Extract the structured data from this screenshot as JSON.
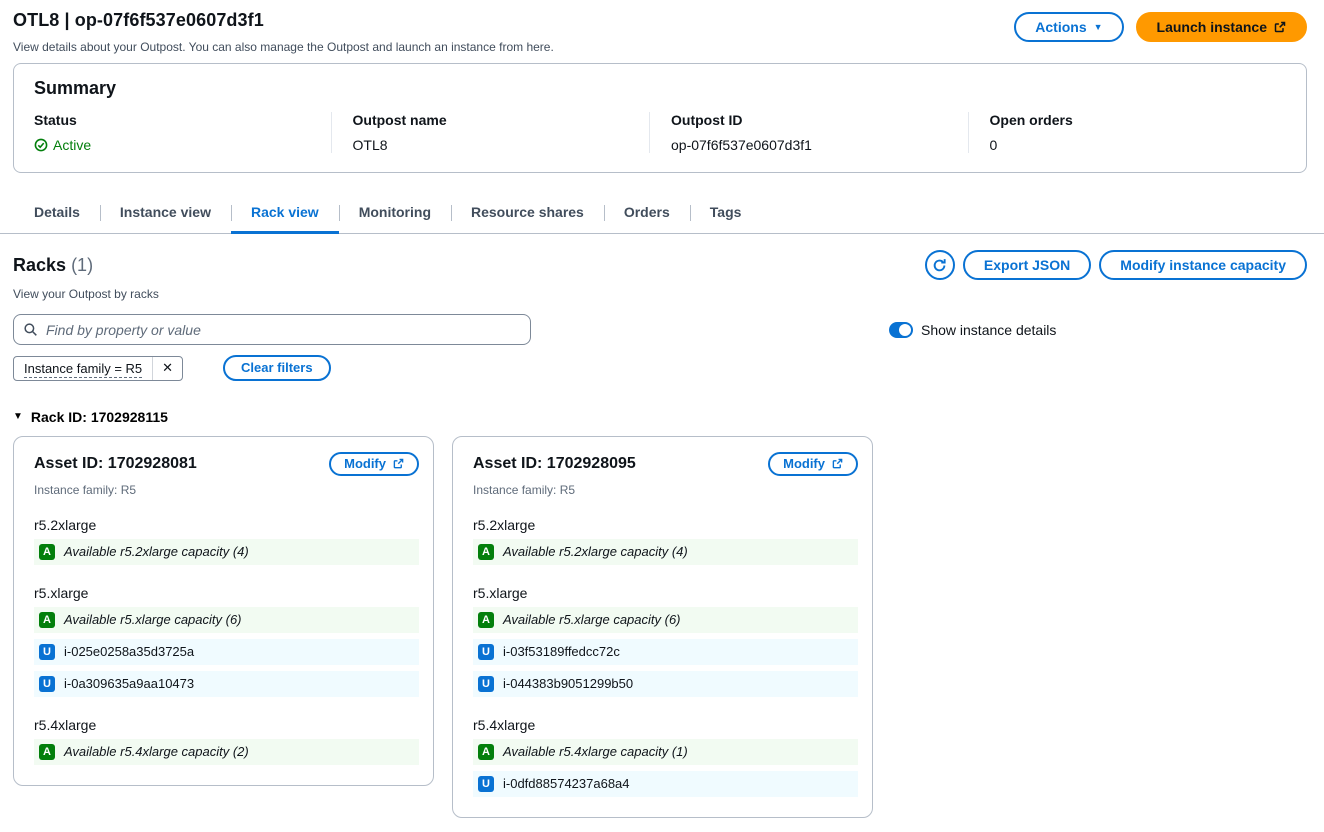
{
  "header": {
    "title": "OTL8 | op-07f6f537e0607d3f1",
    "subtitle": "View details about your Outpost. You can also manage the Outpost and launch an instance from here.",
    "actions_button": "Actions",
    "launch_button": "Launch instance"
  },
  "summary": {
    "heading": "Summary",
    "fields": [
      {
        "label": "Status",
        "value": "Active",
        "icon": "status-check"
      },
      {
        "label": "Outpost name",
        "value": "OTL8"
      },
      {
        "label": "Outpost ID",
        "value": "op-07f6f537e0607d3f1"
      },
      {
        "label": "Open orders",
        "value": "0"
      }
    ]
  },
  "tabs": [
    {
      "label": "Details",
      "active": false
    },
    {
      "label": "Instance view",
      "active": false
    },
    {
      "label": "Rack view",
      "active": true
    },
    {
      "label": "Monitoring",
      "active": false
    },
    {
      "label": "Resource shares",
      "active": false
    },
    {
      "label": "Orders",
      "active": false
    },
    {
      "label": "Tags",
      "active": false
    }
  ],
  "racks": {
    "heading": "Racks",
    "count": "(1)",
    "description": "View your Outpost by racks",
    "export_button": "Export JSON",
    "modify_capacity_button": "Modify instance capacity",
    "search_placeholder": "Find by property or value",
    "toggle_label": "Show instance details",
    "filter_token": "Instance family = R5",
    "clear_filters_button": "Clear filters",
    "rack_header": "Rack ID: 1702928115"
  },
  "row_badges": {
    "available": "A",
    "used": "U"
  },
  "assets": [
    {
      "title": "Asset ID: 1702928081",
      "modify_button": "Modify",
      "family": "Instance family: R5",
      "groups": [
        {
          "type": "r5.2xlarge",
          "rows": [
            {
              "kind": "available",
              "text": "Available r5.2xlarge capacity (4)"
            }
          ]
        },
        {
          "type": "r5.xlarge",
          "rows": [
            {
              "kind": "available",
              "text": "Available r5.xlarge capacity (6)"
            },
            {
              "kind": "used",
              "text": "i-025e0258a35d3725a"
            },
            {
              "kind": "used",
              "text": "i-0a309635a9aa10473"
            }
          ]
        },
        {
          "type": "r5.4xlarge",
          "rows": [
            {
              "kind": "available",
              "text": "Available r5.4xlarge capacity (2)"
            }
          ]
        }
      ]
    },
    {
      "title": "Asset ID: 1702928095",
      "modify_button": "Modify",
      "family": "Instance family: R5",
      "groups": [
        {
          "type": "r5.2xlarge",
          "rows": [
            {
              "kind": "available",
              "text": "Available r5.2xlarge capacity (4)"
            }
          ]
        },
        {
          "type": "r5.xlarge",
          "rows": [
            {
              "kind": "available",
              "text": "Available r5.xlarge capacity (6)"
            },
            {
              "kind": "used",
              "text": "i-03f53189ffedcc72c"
            },
            {
              "kind": "used",
              "text": "i-044383b9051299b50"
            }
          ]
        },
        {
          "type": "r5.4xlarge",
          "rows": [
            {
              "kind": "available",
              "text": "Available r5.4xlarge capacity (1)"
            },
            {
              "kind": "used",
              "text": "i-0dfd88574237a68a4"
            }
          ]
        }
      ]
    }
  ],
  "colors": {
    "accent_blue": "#0972d3",
    "launch_orange": "#ff9900",
    "status_green": "#037f0c",
    "available_row_bg": "#f2fbf2",
    "used_row_bg": "#f0fbff",
    "border_gray": "#b6bec9",
    "text_primary": "#0f141a",
    "text_secondary": "#5f6b7a"
  }
}
